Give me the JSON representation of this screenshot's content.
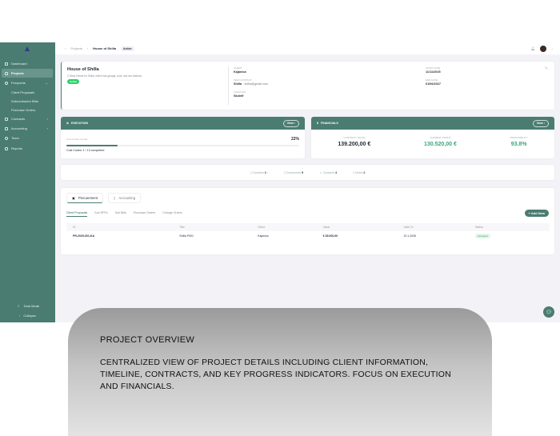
{
  "sidebar": {
    "items": [
      {
        "label": "Dashboard"
      },
      {
        "label": "Projects"
      },
      {
        "label": "Prospects"
      },
      {
        "label": "Client Proposals"
      },
      {
        "label": "Subcontractor Bids"
      },
      {
        "label": "Purchase Orders"
      },
      {
        "label": "Contracts"
      },
      {
        "label": "Accounting"
      },
      {
        "label": "Team"
      },
      {
        "label": "Reports"
      }
    ],
    "dark_mode": "Dark Mode",
    "collapse": "Collapse"
  },
  "topbar": {
    "breadcrumb_parent": "Projects",
    "breadcrumb_current": "House of Shilla",
    "status": "Active"
  },
  "project": {
    "title": "House of Shilla",
    "description": "2-Story House for Shilla, which has garage, pool, and two balkons.",
    "status": "Active",
    "client_label": "Client",
    "client": "Kajanica",
    "contact_label": "Main Contact",
    "contact_name": "Shilla",
    "contact_email": "· shilla@gmail.com",
    "location_label": "Location",
    "location": "Skolelf",
    "start_label": "Start Date",
    "start": "11/11/2025",
    "end_label": "End Date",
    "end": "01/06/2027"
  },
  "execution": {
    "title": "EXECUTION",
    "view": "View ›",
    "cost_label": "Cost Codes Overall",
    "percent": "22%",
    "progress": 0.22,
    "summary": "Cost Codes: 1 / 13 completed"
  },
  "financials": {
    "title": "FINANCIALS",
    "view": "View ›",
    "contract_label": "Contract Value",
    "contract": "139.200,00 €",
    "profit_label": "Current Profit",
    "profit": "130.520,00 €",
    "prof_label": "Profitability",
    "prof": "93.8%"
  },
  "stats": [
    {
      "label": "Contacts",
      "value": "2"
    },
    {
      "label": "Documents",
      "value": "5"
    },
    {
      "label": "Contacts",
      "value": "4"
    },
    {
      "label": "Notes",
      "value": "2"
    }
  ],
  "tabs": {
    "procurement": "Procurement",
    "accounting": "Accounting",
    "subtabs": [
      "Client Proposals",
      "Sub RFPs",
      "Sub Bids",
      "Purchase Orders",
      "Change Orders"
    ],
    "add_new": "+ Add New"
  },
  "table": {
    "headers": [
      "ID",
      "Title",
      "Client",
      "Value",
      "Valid To",
      "Status"
    ],
    "rows": [
      [
        "PR-2025-001-KA",
        "Shilla P001",
        "Kajanica",
        "€ 35.000,00",
        "10.1.2026",
        "Accepted"
      ]
    ]
  },
  "overlay": {
    "title": "PROJECT OVERVIEW",
    "description": "CENTRALIZED VIEW OF PROJECT DETAILS INCLUDING CLIENT INFORMATION, TIMELINE, CONTRACTS, AND KEY PROGRESS INDICATORS. FOCUS ON EXECUTION AND FINANCIALS."
  }
}
